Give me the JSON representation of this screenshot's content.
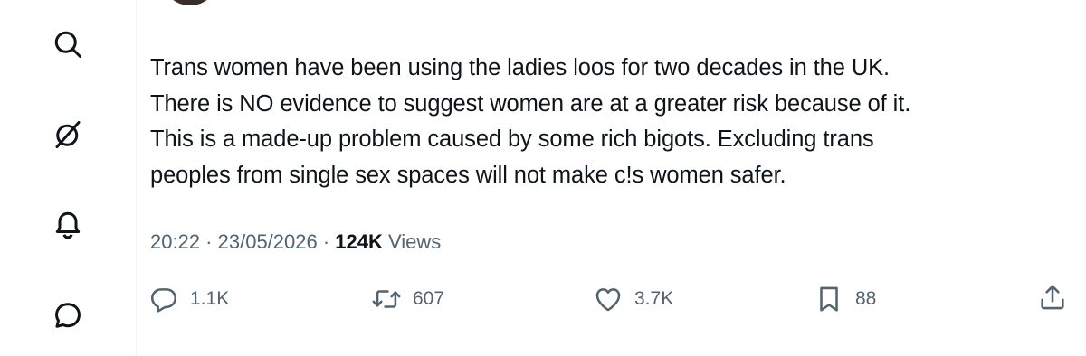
{
  "nav": {
    "icons": [
      "search-icon",
      "grok-icon",
      "notifications-icon",
      "messages-icon"
    ]
  },
  "tweet": {
    "lines": [
      "Trans women have been using the ladies loos for two decades in the UK.",
      "There is NO evidence to suggest women are at a greater risk because of it.",
      "This is a made-up problem caused by some rich bigots. Excluding trans",
      "peoples from single sex spaces will not make c!s women safer."
    ],
    "time": "20:22",
    "separator": " · ",
    "date": "23/05/2026",
    "views_count": "124K",
    "views_label": " Views"
  },
  "actions": {
    "replies": "1.1K",
    "reposts": "607",
    "likes": "3.7K",
    "bookmarks": "88"
  },
  "colors": {
    "text": "#0f1419",
    "muted": "#536471",
    "divider": "#eff3f4"
  }
}
